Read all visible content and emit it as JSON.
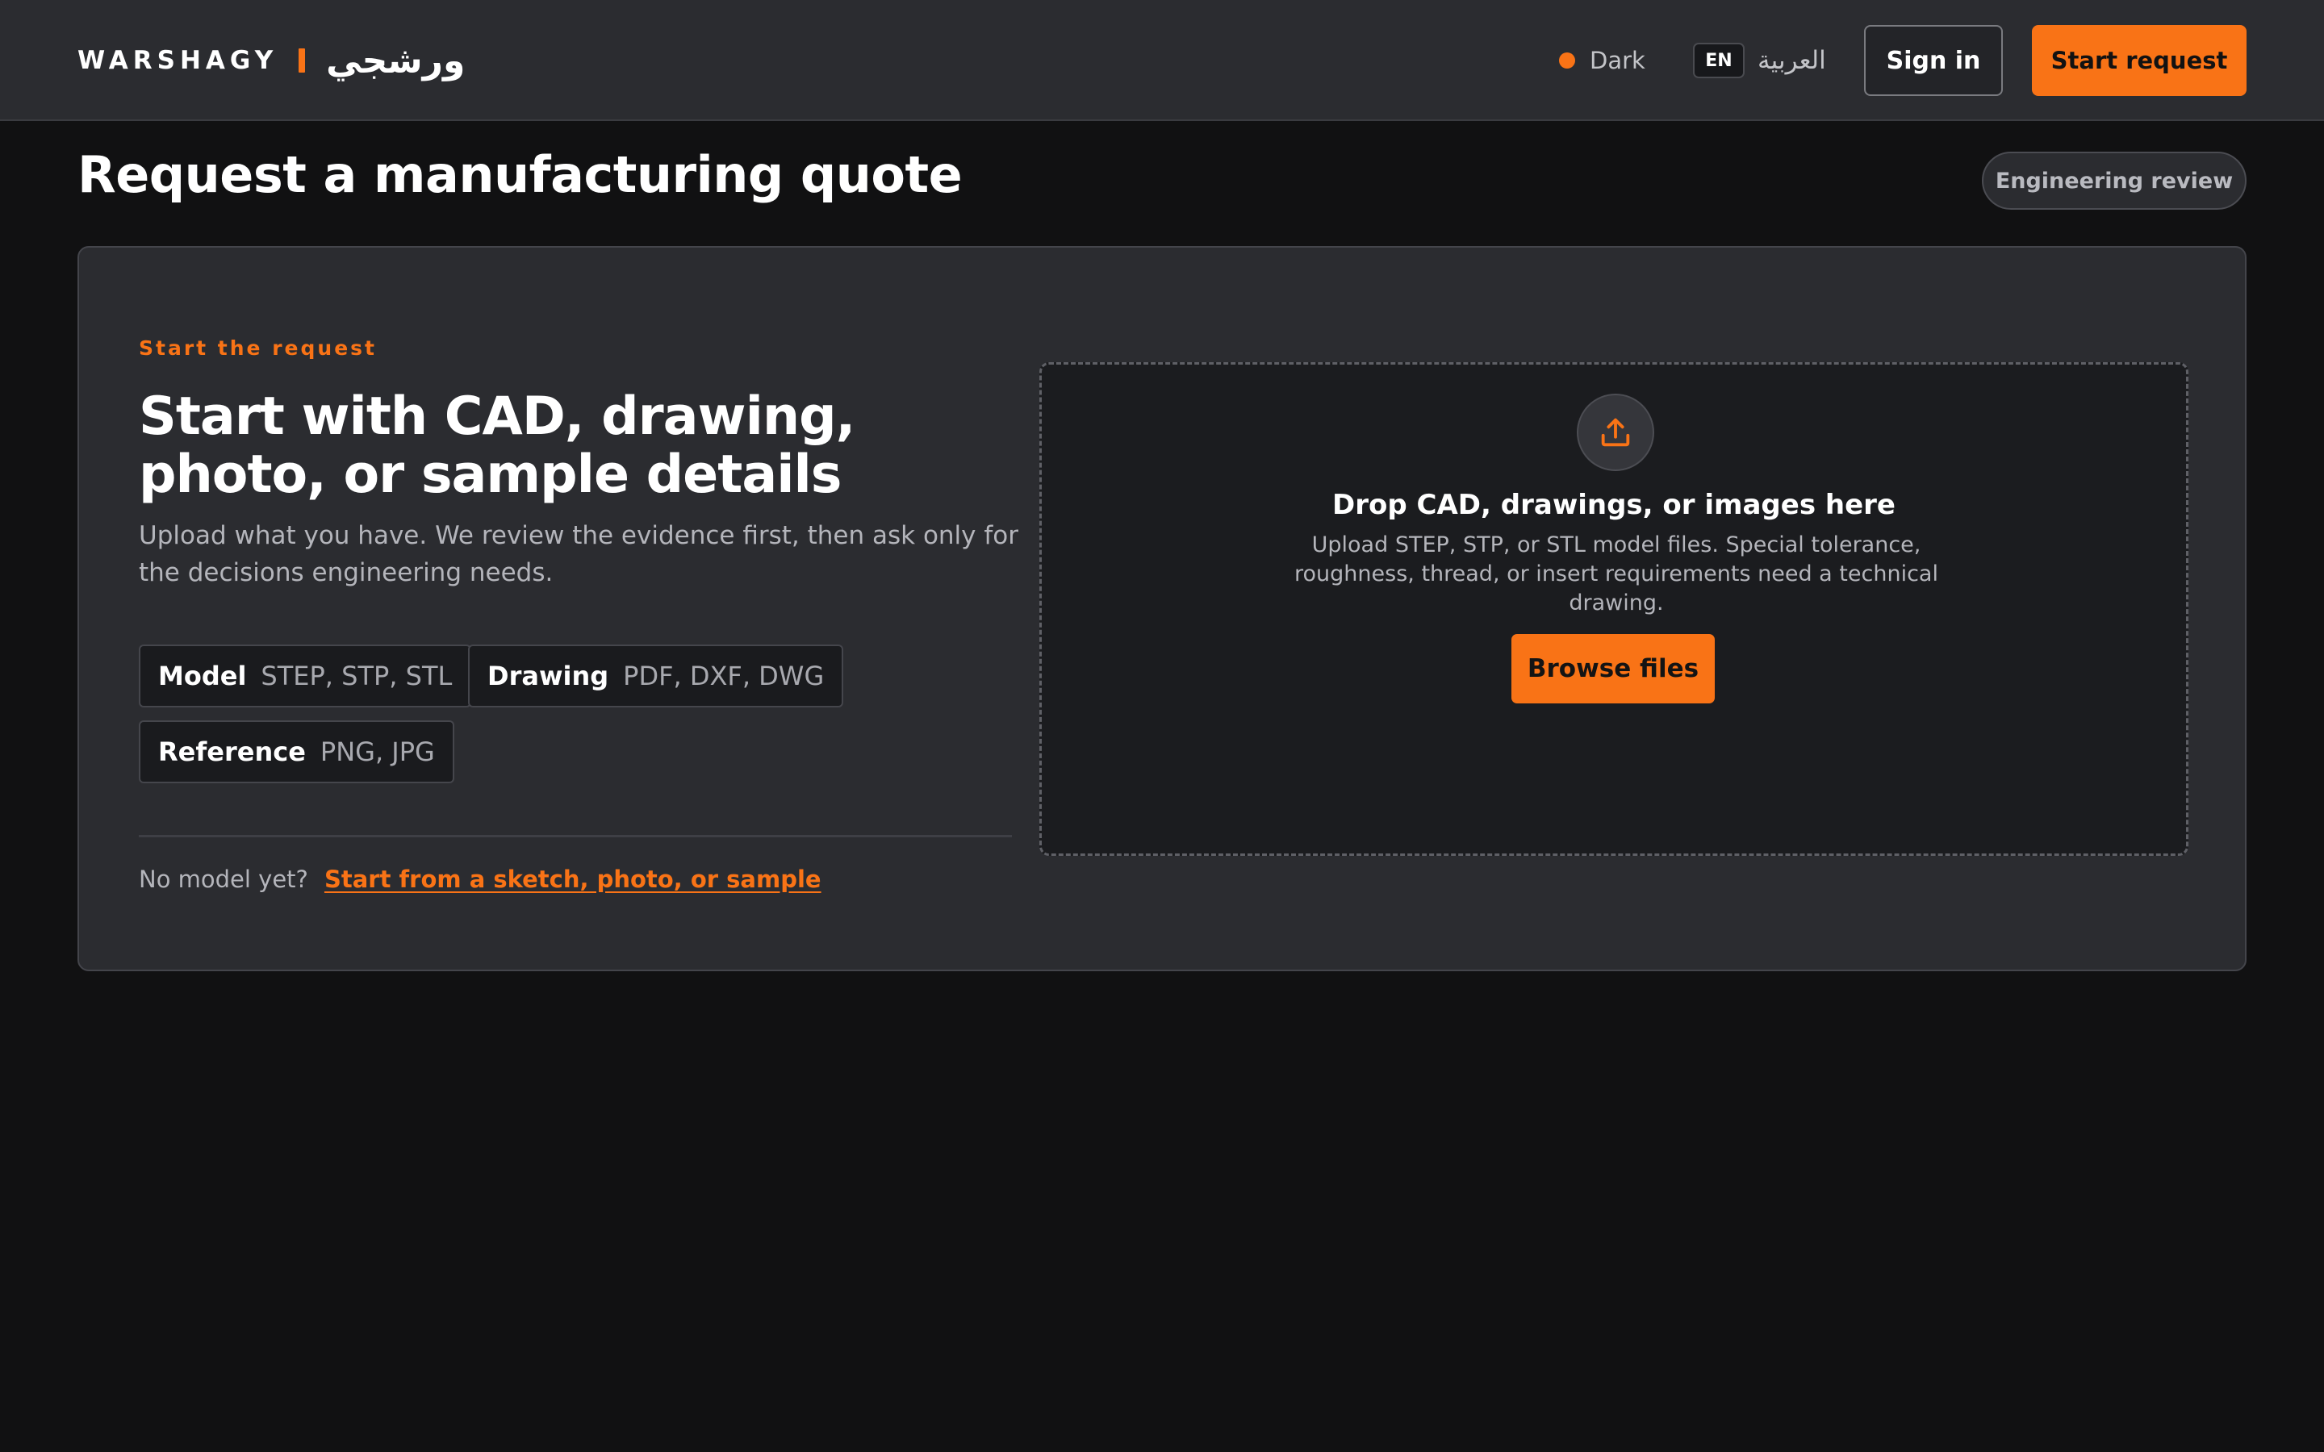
{
  "header": {
    "brand_en": "WARSHAGY",
    "brand_ar": "ورشجي",
    "theme_label": "Dark",
    "lang_current": "EN",
    "lang_alt": "العربية",
    "signin_label": "Sign in",
    "start_label": "Start request"
  },
  "page": {
    "title": "Request a manufacturing quote",
    "badge": "Engineering review"
  },
  "intro": {
    "eyebrow": "Start the request",
    "heading": "Start with CAD, drawing, photo, or sample details",
    "lead": "Upload what you have. We review the evidence first, then ask only for the decisions engineering needs."
  },
  "file_types": [
    {
      "key": "Model",
      "value": "STEP, STP, STL"
    },
    {
      "key": "Drawing",
      "value": "PDF, DXF, DWG"
    },
    {
      "key": "Reference",
      "value": "PNG, JPG"
    }
  ],
  "no_model": {
    "question": "No model yet?",
    "link": "Start from a sketch, photo, or sample"
  },
  "dropzone": {
    "icon": "upload-icon",
    "title": "Drop CAD, drawings, or images here",
    "help": "Upload STEP, STP, or STL model files. Special tolerance, roughness, thread, or insert requirements need a technical drawing.",
    "browse_label": "Browse files"
  },
  "colors": {
    "accent": "#f97316",
    "surface": "#2b2c30",
    "background": "#111112"
  }
}
